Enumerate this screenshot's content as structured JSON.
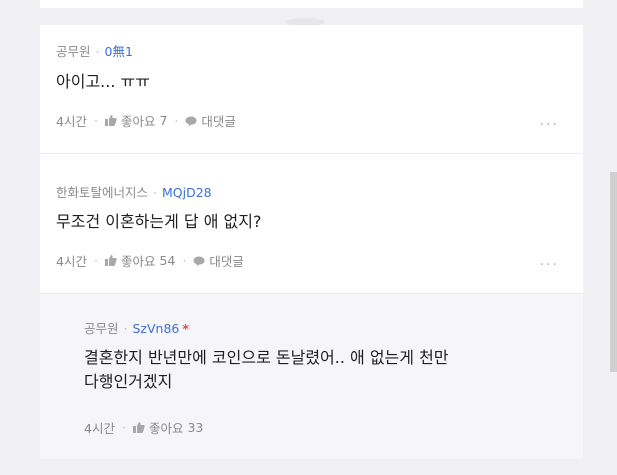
{
  "comments": [
    {
      "author": "공무원",
      "nickname": "0無1",
      "text": "아이고... ㅠㅠ",
      "time": "4시간",
      "like_label": "좋아요",
      "like_count": "7",
      "reply_label": "대댓글",
      "more": "..."
    },
    {
      "author": "한화토탈에너지스",
      "nickname": "MQjD28",
      "text": "무조건 이혼하는게 답 애 없지?",
      "time": "4시간",
      "like_label": "좋아요",
      "like_count": "54",
      "reply_label": "대댓글",
      "more": "..."
    }
  ],
  "reply": {
    "author": "공무원",
    "nickname": "SzVn86",
    "badge": "*",
    "text_line1": "결혼한지 반년만에 코인으로 돈날렸어.. 애 없는게 천만",
    "text_line2": "다행인거겠지",
    "time": "4시간",
    "like_label": "좋아요",
    "like_count": "33"
  },
  "separator": "·",
  "colors": {
    "nickname": "#3d6fd6",
    "badge": "#e64b4b",
    "meta": "#8a8a8a",
    "reply_bg": "#f6f6f8"
  }
}
